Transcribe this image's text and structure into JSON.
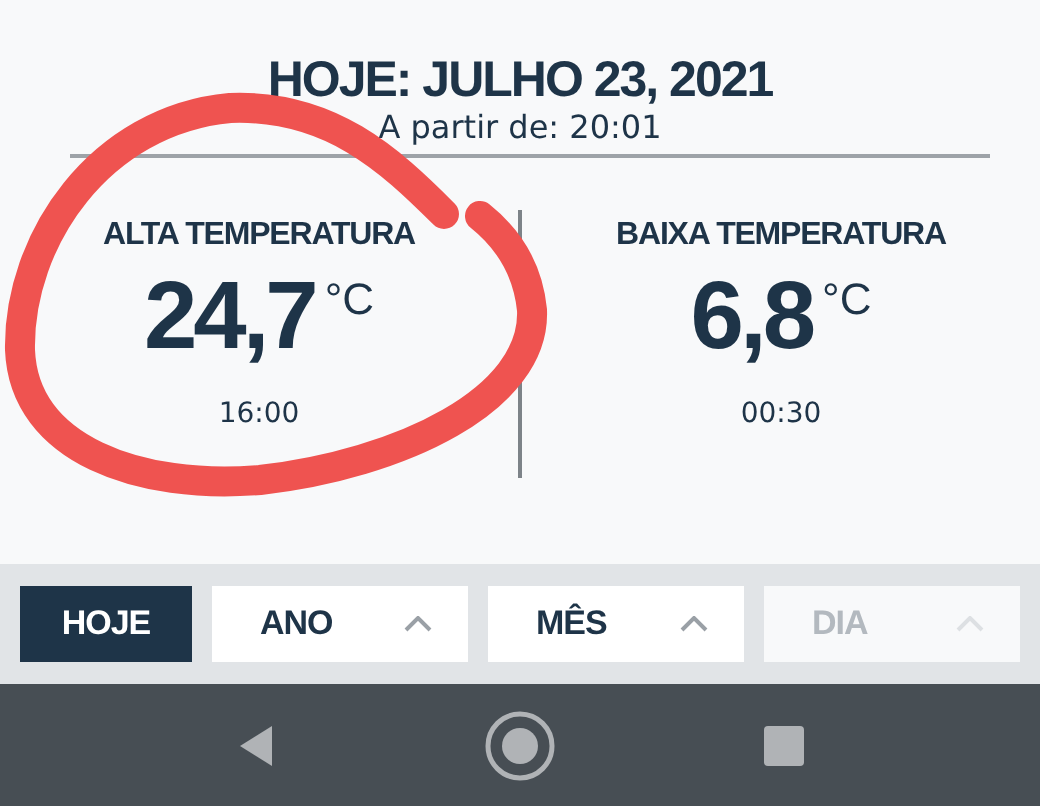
{
  "header": {
    "title": "HOJE: JULHO 23, 2021",
    "subtitle": "A partir de: 20:01"
  },
  "readings": [
    {
      "label": "ALTA TEMPERATURA",
      "value": "24,7",
      "unit": "°C",
      "time": "16:00",
      "circled": true
    },
    {
      "label": "BAIXA TEMPERATURA",
      "value": "6,8",
      "unit": "°C",
      "time": "00:30",
      "circled": false
    }
  ],
  "periods": [
    {
      "label": "HOJE",
      "selected": true,
      "disabled": false,
      "dropdown": false
    },
    {
      "label": "ANO",
      "selected": false,
      "disabled": false,
      "dropdown": true
    },
    {
      "label": "MÊS",
      "selected": false,
      "disabled": false,
      "dropdown": true
    },
    {
      "label": "DIA",
      "selected": false,
      "disabled": true,
      "dropdown": true
    }
  ]
}
